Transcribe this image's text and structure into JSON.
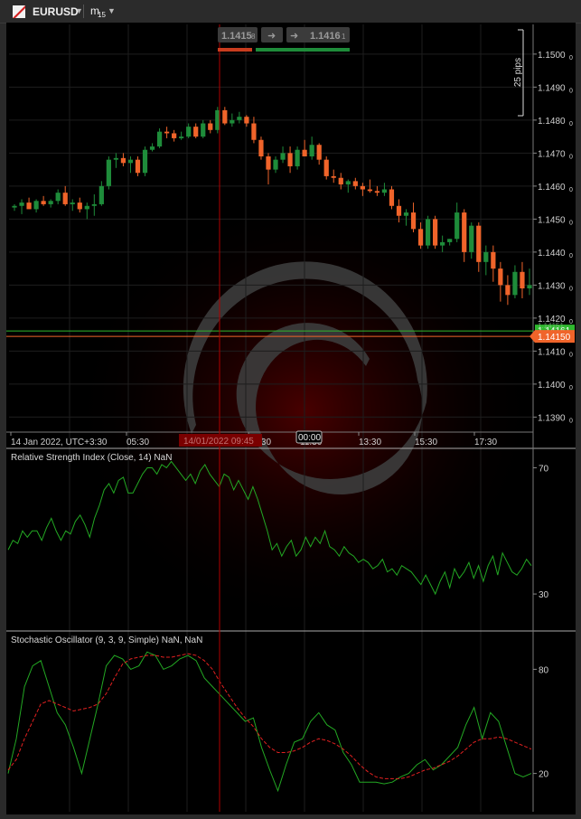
{
  "window": {
    "symbol": "EURUSD",
    "timeframe": "m",
    "timeframe_sub": "15"
  },
  "trade_buttons": {
    "sell_price": "1.1415",
    "sell_price_sup": "8",
    "buy_price": "1.1416",
    "buy_price_sup": "1"
  },
  "scale_marker": "25 pips",
  "colors": {
    "bull": "#1e8c3a",
    "bear": "#f0642a",
    "crosshair": "#b00000",
    "rsi": "#23a823",
    "stoch_k": "#23a823",
    "stoch_d": "#e02020",
    "ask_line": "#2fb82f",
    "bid_line": "#f0642a"
  },
  "chart_data": [
    {
      "type": "candlestick",
      "title": "EURUSD m15",
      "ylim": [
        1.1386,
        1.1509
      ],
      "y_ticks": [
        {
          "value": 1.15,
          "label": "1.1500",
          "sup": "0"
        },
        {
          "value": 1.149,
          "label": "1.1490",
          "sup": "0"
        },
        {
          "value": 1.148,
          "label": "1.1480",
          "sup": "0"
        },
        {
          "value": 1.147,
          "label": "1.1470",
          "sup": "0"
        },
        {
          "value": 1.146,
          "label": "1.1460",
          "sup": "0"
        },
        {
          "value": 1.145,
          "label": "1.1450",
          "sup": "0"
        },
        {
          "value": 1.144,
          "label": "1.1440",
          "sup": "0"
        },
        {
          "value": 1.143,
          "label": "1.1430",
          "sup": "0"
        },
        {
          "value": 1.142,
          "label": "1.1420",
          "sup": "0"
        },
        {
          "value": 1.141,
          "label": "1.1410",
          "sup": "0"
        },
        {
          "value": 1.14,
          "label": "1.1400",
          "sup": "0"
        },
        {
          "value": 1.139,
          "label": "1.1390",
          "sup": "0"
        }
      ],
      "current_ask": {
        "value": 1.14161,
        "label": "1.14161"
      },
      "current_bid": {
        "value": 1.1415,
        "label": "1.14150"
      },
      "x_ticks": [
        "14 Jan 2022, UTC+3:30",
        "05:30",
        "09:30",
        "11:30",
        "13:30",
        "15:30",
        "17:30"
      ],
      "crosshair_time": "14/01/2022 09:45",
      "crosshair_price_hint": "1.14151",
      "cursor_time": "00:00",
      "candles": [
        [
          1.14535,
          1.14545,
          1.14525,
          1.1454
        ],
        [
          1.1454,
          1.1456,
          1.14515,
          1.1455
        ],
        [
          1.1455,
          1.14565,
          1.14535,
          1.1453
        ],
        [
          1.1453,
          1.1456,
          1.1452,
          1.14555
        ],
        [
          1.14555,
          1.1457,
          1.1454,
          1.14545
        ],
        [
          1.14545,
          1.1456,
          1.14535,
          1.14555
        ],
        [
          1.14555,
          1.1459,
          1.14545,
          1.1458
        ],
        [
          1.1458,
          1.146,
          1.1454,
          1.14545
        ],
        [
          1.14545,
          1.1456,
          1.14525,
          1.1455
        ],
        [
          1.1455,
          1.14565,
          1.1452,
          1.1453
        ],
        [
          1.1453,
          1.1455,
          1.145,
          1.1454
        ],
        [
          1.1454,
          1.14575,
          1.1451,
          1.14545
        ],
        [
          1.14545,
          1.14615,
          1.1454,
          1.146
        ],
        [
          1.146,
          1.1469,
          1.1459,
          1.1468
        ],
        [
          1.1468,
          1.147,
          1.14655,
          1.14685
        ],
        [
          1.14685,
          1.147,
          1.1466,
          1.1467
        ],
        [
          1.1467,
          1.1469,
          1.1464,
          1.1468
        ],
        [
          1.1468,
          1.1469,
          1.1463,
          1.1464
        ],
        [
          1.1464,
          1.1472,
          1.1463,
          1.1471
        ],
        [
          1.1471,
          1.1473,
          1.14705,
          1.1472
        ],
        [
          1.1472,
          1.14775,
          1.14715,
          1.14765
        ],
        [
          1.14765,
          1.1478,
          1.14745,
          1.1476
        ],
        [
          1.1476,
          1.1477,
          1.14735,
          1.14745
        ],
        [
          1.14745,
          1.14765,
          1.1474,
          1.1475
        ],
        [
          1.1475,
          1.1479,
          1.14745,
          1.1478
        ],
        [
          1.1478,
          1.1479,
          1.14745,
          1.1475
        ],
        [
          1.1475,
          1.148,
          1.14745,
          1.1479
        ],
        [
          1.1479,
          1.148,
          1.1476,
          1.1477
        ],
        [
          1.1477,
          1.1484,
          1.1476,
          1.1483
        ],
        [
          1.1483,
          1.1484,
          1.14785,
          1.1479
        ],
        [
          1.1479,
          1.1482,
          1.1478,
          1.148
        ],
        [
          1.148,
          1.14825,
          1.1479,
          1.1481
        ],
        [
          1.1481,
          1.14815,
          1.1478,
          1.1479
        ],
        [
          1.1479,
          1.1481,
          1.1473,
          1.1474
        ],
        [
          1.1474,
          1.1475,
          1.1468,
          1.1469
        ],
        [
          1.1469,
          1.147,
          1.14605,
          1.1465
        ],
        [
          1.1465,
          1.1469,
          1.1464,
          1.1468
        ],
        [
          1.1468,
          1.1472,
          1.1467,
          1.147
        ],
        [
          1.147,
          1.1472,
          1.1464,
          1.1466
        ],
        [
          1.1466,
          1.1472,
          1.1465,
          1.1471
        ],
        [
          1.1471,
          1.1474,
          1.147,
          1.1469
        ],
        [
          1.1469,
          1.1475,
          1.1468,
          1.14725
        ],
        [
          1.14725,
          1.1473,
          1.14665,
          1.1468
        ],
        [
          1.1468,
          1.1469,
          1.1462,
          1.1463
        ],
        [
          1.1463,
          1.1465,
          1.1461,
          1.14625
        ],
        [
          1.14625,
          1.1464,
          1.1459,
          1.14605
        ],
        [
          1.14605,
          1.1462,
          1.1458,
          1.14615
        ],
        [
          1.14615,
          1.14625,
          1.1459,
          1.146
        ],
        [
          1.146,
          1.1461,
          1.1457,
          1.1459
        ],
        [
          1.1459,
          1.1462,
          1.1458,
          1.14585
        ],
        [
          1.14585,
          1.146,
          1.1457,
          1.1458
        ],
        [
          1.1458,
          1.1461,
          1.1457,
          1.1459
        ],
        [
          1.1459,
          1.146,
          1.1453,
          1.1454
        ],
        [
          1.1454,
          1.1456,
          1.1449,
          1.1451
        ],
        [
          1.1451,
          1.1453,
          1.1448,
          1.1452
        ],
        [
          1.1452,
          1.1455,
          1.1446,
          1.1447
        ],
        [
          1.1447,
          1.1449,
          1.1441,
          1.1442
        ],
        [
          1.1442,
          1.1451,
          1.1441,
          1.145
        ],
        [
          1.145,
          1.1451,
          1.1441,
          1.1442
        ],
        [
          1.1442,
          1.1445,
          1.144,
          1.1443
        ],
        [
          1.1443,
          1.1444,
          1.1442,
          1.1444
        ],
        [
          1.1444,
          1.1455,
          1.1443,
          1.1452
        ],
        [
          1.1452,
          1.1453,
          1.1437,
          1.144
        ],
        [
          1.144,
          1.1449,
          1.1438,
          1.1448
        ],
        [
          1.1448,
          1.1449,
          1.1434,
          1.1437
        ],
        [
          1.1437,
          1.1442,
          1.1433,
          1.144
        ],
        [
          1.144,
          1.1442,
          1.1431,
          1.1435
        ],
        [
          1.1435,
          1.1437,
          1.1425,
          1.143
        ],
        [
          1.143,
          1.1433,
          1.1424,
          1.1427
        ],
        [
          1.1427,
          1.1436,
          1.1426,
          1.1434
        ],
        [
          1.1434,
          1.1437,
          1.1426,
          1.1429
        ],
        [
          1.1429,
          1.1435,
          1.1427,
          1.143
        ]
      ]
    },
    {
      "type": "line",
      "title": "Relative Strength Index (Close, 14) NaN",
      "ylim": [
        20,
        75
      ],
      "y_ticks": [
        {
          "value": 70,
          "label": "70"
        },
        {
          "value": 30,
          "label": "30"
        }
      ],
      "series": [
        {
          "values": [
            44,
            47,
            46,
            50,
            48,
            50,
            50,
            47,
            51,
            54,
            50,
            47,
            50,
            49,
            53,
            55,
            52,
            48,
            54,
            58,
            63,
            65,
            62,
            66,
            67,
            62,
            62,
            65,
            68,
            70,
            70,
            68,
            71,
            70,
            72,
            70,
            68,
            66,
            68,
            65,
            69,
            71,
            68,
            66,
            64,
            68,
            67,
            63,
            66,
            63,
            60,
            64,
            60,
            55,
            50,
            44,
            46,
            42,
            45,
            47,
            42,
            44,
            48,
            45,
            48,
            46,
            50,
            45,
            44,
            42,
            45,
            43,
            42,
            40,
            41,
            40,
            38,
            39,
            41,
            37,
            38,
            36,
            39,
            38,
            37,
            35,
            33,
            36,
            33,
            30,
            34,
            37,
            32,
            38,
            35,
            37,
            40,
            35,
            39,
            34,
            39,
            42,
            36,
            43,
            40,
            37,
            36,
            38,
            41,
            39
          ]
        }
      ]
    },
    {
      "type": "line",
      "title": "Stochastic Oscillator (9, 3, 9, Simple) NaN, NaN",
      "ylim": [
        0,
        100
      ],
      "y_ticks": [
        {
          "value": 80,
          "label": "80"
        },
        {
          "value": 20,
          "label": "20"
        }
      ],
      "series": [
        {
          "values": [
            20,
            40,
            70,
            82,
            85,
            70,
            55,
            48,
            35,
            20,
            40,
            60,
            82,
            88,
            86,
            80,
            82,
            90,
            88,
            80,
            82,
            86,
            88,
            85,
            75,
            70,
            65,
            60,
            55,
            50,
            52,
            35,
            22,
            10,
            25,
            38,
            40,
            50,
            55,
            48,
            45,
            32,
            25,
            15,
            15,
            15,
            14,
            15,
            18,
            20,
            25,
            28,
            22,
            25,
            30,
            35,
            48,
            58,
            40,
            55,
            50,
            35,
            20,
            18,
            20
          ]
        },
        {
          "values": [
            22,
            28,
            40,
            50,
            60,
            62,
            60,
            58,
            56,
            57,
            58,
            60,
            66,
            75,
            83,
            86,
            87,
            88,
            88,
            87,
            87,
            88,
            89,
            88,
            85,
            80,
            72,
            65,
            58,
            52,
            47,
            40,
            35,
            32,
            32,
            33,
            35,
            38,
            40,
            39,
            37,
            34,
            30,
            25,
            21,
            18,
            17,
            17,
            17,
            18,
            20,
            22,
            23,
            25,
            27,
            30,
            34,
            38,
            40,
            40,
            41,
            40,
            38,
            36,
            34
          ]
        }
      ]
    }
  ]
}
